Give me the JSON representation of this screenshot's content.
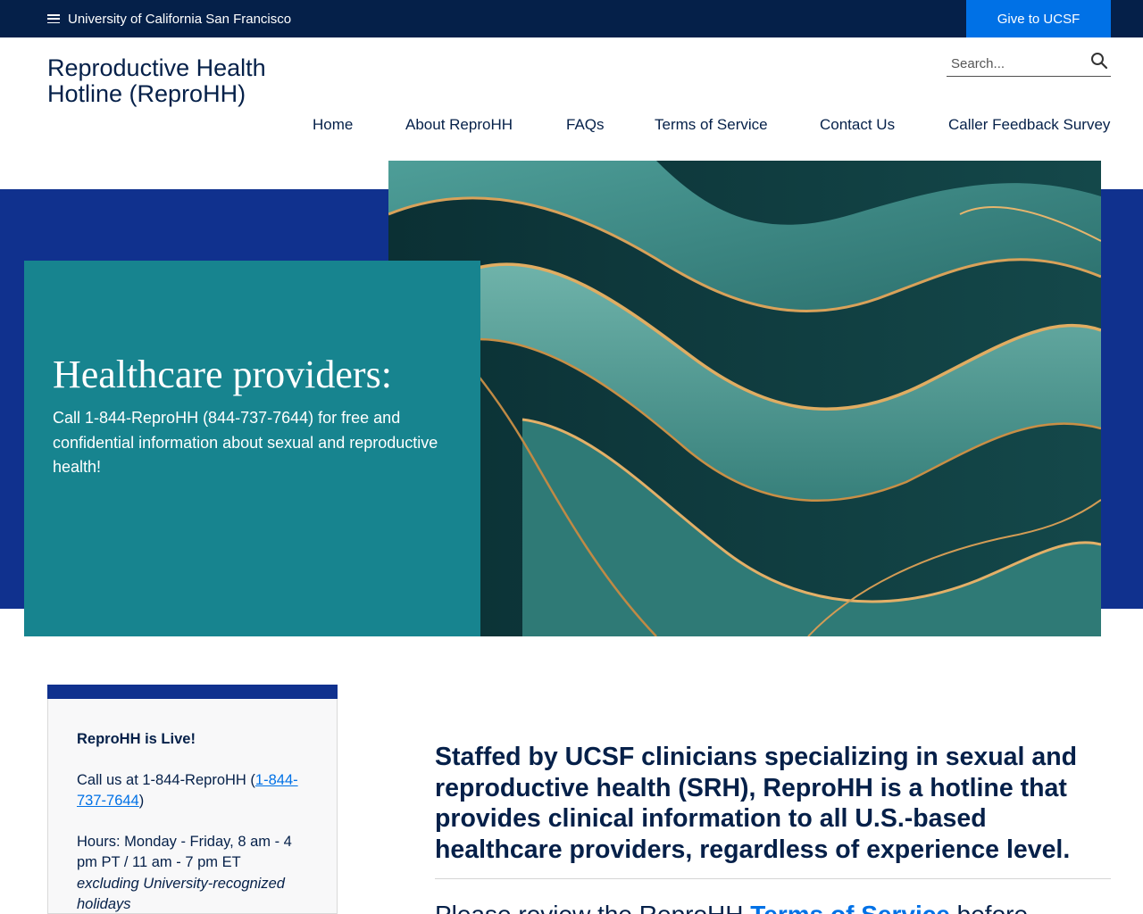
{
  "topbar": {
    "menu_label": "University of California San Francisco",
    "give_label": "Give to UCSF"
  },
  "header": {
    "site_title": "Reproductive Health Hotline (ReproHH)",
    "search_placeholder": "Search..."
  },
  "nav": {
    "items": [
      "Home",
      "About ReproHH",
      "FAQs",
      "Terms of Service",
      "Contact Us",
      "Caller Feedback Survey"
    ]
  },
  "hero": {
    "title": "Healthcare providers:",
    "text": "Call 1-844-ReproHH (844-737-7644) for free and confidential information about sexual and reproductive health!"
  },
  "sidebar": {
    "heading": "ReproHH is Live!",
    "call_prefix": "Call us at 1-844-ReproHH (",
    "call_link": "1-844-737-7644",
    "call_suffix": ")",
    "hours": "Hours: Monday - Friday, 8 am - 4 pm PT / 11 am - 7 pm ET",
    "hours_note": "excluding University-recognized holidays"
  },
  "main": {
    "lead": "Staffed by UCSF clinicians specializing in sexual and reproductive health (SRH), ReproHH is a hotline that provides clinical information to all U.S.-based healthcare providers, regardless of experience level.",
    "next_prefix": "Please review the ReproHH ",
    "next_link": "Terms of Service",
    "next_suffix": " before"
  },
  "colors": {
    "navy": "#052049",
    "accent_blue": "#0071e6",
    "band_blue": "#10318e",
    "teal": "#17848f"
  }
}
